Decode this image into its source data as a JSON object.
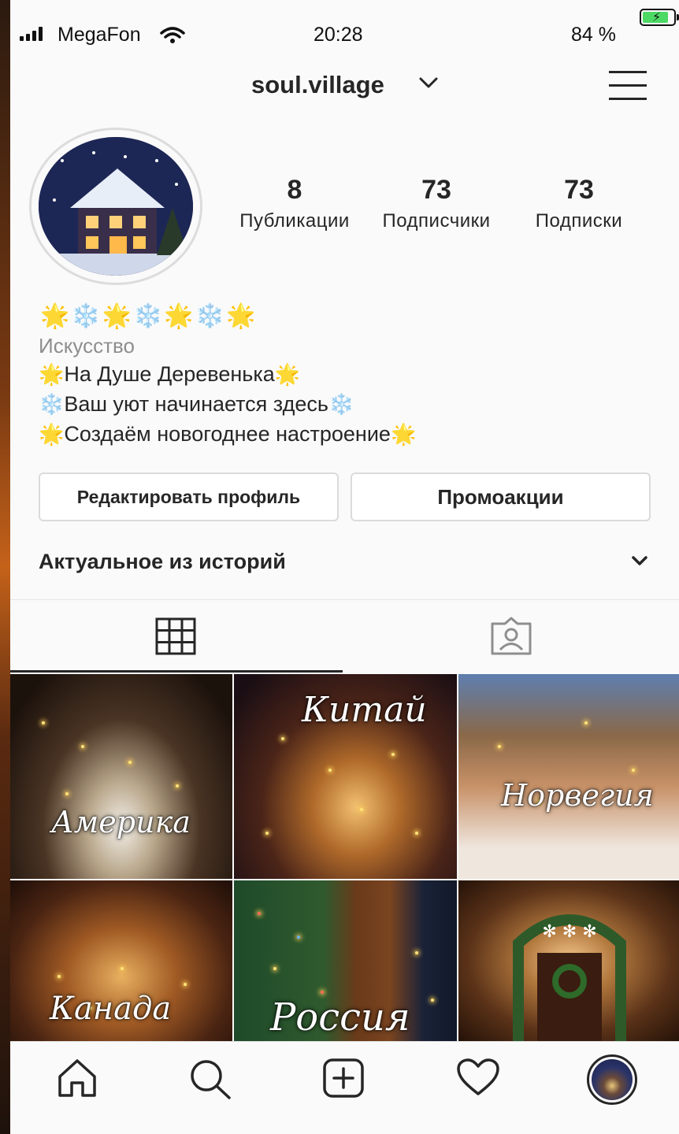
{
  "status_bar": {
    "carrier": "MegaFon",
    "time": "20:28",
    "battery": "84 %",
    "battery_level": 0.84
  },
  "header": {
    "username": "soul.village"
  },
  "profile": {
    "stats": [
      {
        "value": "8",
        "label": "Публикации"
      },
      {
        "value": "73",
        "label": "Подписчики"
      },
      {
        "value": "73",
        "label": "Подписки"
      }
    ],
    "bio": {
      "emoji_row": "🌟❄️🌟❄️🌟❄️🌟",
      "category": "Искусство",
      "lines": [
        {
          "lead": "🌟",
          "text": "На Душе Деревенька",
          "trail": "🌟"
        },
        {
          "lead": "❄️",
          "text": "Ваш уют начинается здесь",
          "trail": "❄️"
        },
        {
          "lead": "🌟",
          "text": "Создаём новогоднее настроение",
          "trail": "🌟"
        }
      ]
    },
    "buttons": {
      "edit": "Редактировать профиль",
      "promo": "Промоакции"
    },
    "highlights_label": "Актуальное из историй"
  },
  "posts": [
    {
      "caption": "Америка"
    },
    {
      "caption": "Китай"
    },
    {
      "caption": "Норвегия"
    },
    {
      "caption": "Канада"
    },
    {
      "caption": "Россия"
    },
    {
      "caption": ""
    }
  ],
  "colors": {
    "text": "#262626",
    "muted": "#8e8e8e",
    "border": "#dbdbdb",
    "battery_green": "#4cd964"
  }
}
